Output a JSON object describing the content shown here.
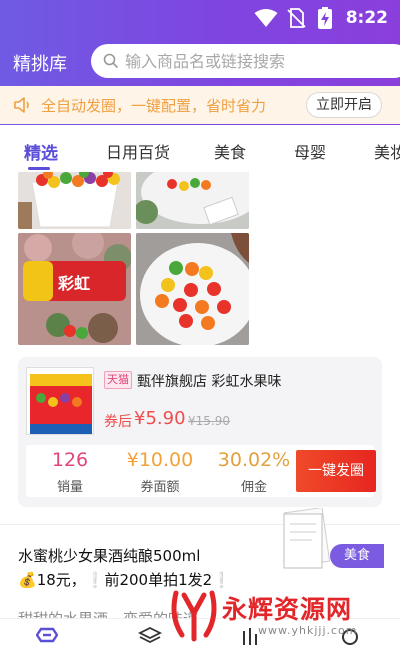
{
  "status_bar": {
    "time": "8:22"
  },
  "header": {
    "app_title": "精挑库",
    "search_placeholder": "输入商品名或链接搜索"
  },
  "notice": {
    "text": "全自动发圈，一键配置，省时省力",
    "button_label": "立即开启"
  },
  "tabs": [
    {
      "label": "精选",
      "active": true
    },
    {
      "label": "日用百货"
    },
    {
      "label": "美食"
    },
    {
      "label": "母婴"
    },
    {
      "label": "美妆"
    }
  ],
  "product": {
    "platform_badge": "天猫",
    "title": "甄伴旗舰店 彩虹水果味",
    "price_label": "券后",
    "price": "¥5.90",
    "original_price": "¥15.90",
    "stats": [
      {
        "value": "126",
        "label": "销量"
      },
      {
        "value": "¥10.00",
        "label": "券面额"
      },
      {
        "value": "30.02%",
        "label": "佣金"
      }
    ],
    "action_label": "一键发圈"
  },
  "post": {
    "title": "水蜜桃少女果酒纯酿500ml",
    "line2_price": "18元，",
    "line2_promo": "前200单拍1发2",
    "line3": "甜甜的水果酒，恋爱的味道",
    "category_badge": "美食"
  },
  "watermark": {
    "text": "永辉资源网",
    "url": "www.yhkjjj.com"
  },
  "colors": {
    "accent": "#5b4fd9",
    "price": "#ef4e4e",
    "notice_text": "#f0a040",
    "action": "#e62620"
  }
}
